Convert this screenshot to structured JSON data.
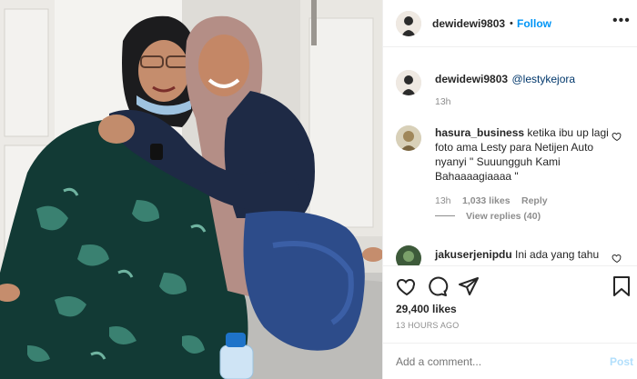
{
  "post": {
    "author": "dewidewi9803",
    "follow_label": "Follow",
    "separator": "•",
    "caption_user": "dewidewi9803",
    "caption_mention": "@lestykejora",
    "caption_time": "13h"
  },
  "comments": [
    {
      "user": "hasura_business",
      "text": "ketika ibu up lagi foto ama Lesty para Netijen Auto nyanyi \" Suuungguh Kami Bahaaaagiaaaa \"",
      "time": "13h",
      "likes": "1,033 likes",
      "reply_label": "Reply",
      "view_replies": "View replies (40)"
    },
    {
      "user": "jakuserjenipdu",
      "text": "Ini ada yang tahu"
    }
  ],
  "stats": {
    "likes": "29,400 likes",
    "timestamp": "13 HOURS AGO"
  },
  "add_comment": {
    "placeholder": "Add a comment...",
    "post_label": "Post"
  },
  "icons": {
    "like": "heart-icon",
    "comment": "comment-icon",
    "share": "paper-plane-icon",
    "save": "bookmark-icon"
  },
  "colors": {
    "link": "#0095f6",
    "muted": "#8e8e8e",
    "text": "#262626"
  }
}
